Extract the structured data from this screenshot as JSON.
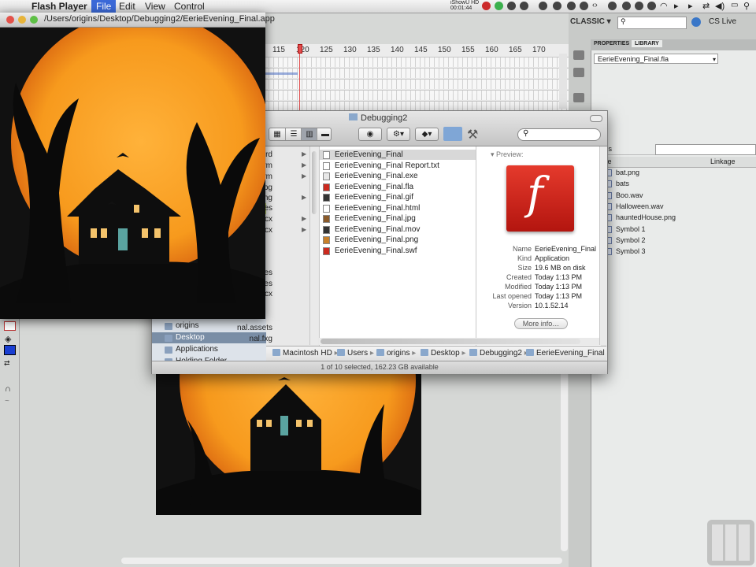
{
  "menubar": {
    "app_name": "Flash Player",
    "items": [
      "File",
      "Edit",
      "View",
      "Control"
    ],
    "recorder": {
      "name": "iShowU HD",
      "time": "00:01:44"
    }
  },
  "ide": {
    "workspace": "CLASSIC",
    "cs_live": "CS Live",
    "panel_tabs": [
      "PROPERTIES",
      "LIBRARY"
    ],
    "library_file": "EerieEvening_Final.fla",
    "library_header": {
      "name_col": "me",
      "linkage_col": "Linkage",
      "items_label": "ems"
    },
    "library_items": [
      "bat.png",
      "bats",
      "Boo.wav",
      "Halloween.wav",
      "hauntedHouse.png",
      "Symbol 1",
      "Symbol 2",
      "Symbol 3"
    ],
    "timeline_frames": [
      "115",
      "120",
      "125",
      "130",
      "135",
      "140",
      "145",
      "150",
      "155",
      "160",
      "165",
      "170"
    ]
  },
  "flash_player": {
    "title_path": "/Users/origins/Desktop/Debugging2/EerieEvening_Final.app"
  },
  "finder": {
    "title": "Debugging2",
    "sidebar_items": [
      "rd",
      "owstorm",
      "owstorm",
      "bell.jpg",
      "hed.png",
      "les",
      "docx",
      "cx",
      "es",
      "Images",
      "pe.docx",
      "origins",
      "Desktop",
      "Applications",
      "Holding Folder",
      "nal.assets",
      "nal.fxg"
    ],
    "files": [
      {
        "name": "EerieEvening_Final",
        "icon": "application-icon"
      },
      {
        "name": "EerieEvening_Final Report.txt",
        "icon": "text-file-icon"
      },
      {
        "name": "EerieEvening_Final.exe",
        "icon": "exe-file-icon"
      },
      {
        "name": "EerieEvening_Final.fla",
        "icon": "fla-file-icon"
      },
      {
        "name": "EerieEvening_Final.gif",
        "icon": "gif-file-icon"
      },
      {
        "name": "EerieEvening_Final.html",
        "icon": "html-file-icon"
      },
      {
        "name": "EerieEvening_Final.jpg",
        "icon": "jpg-file-icon"
      },
      {
        "name": "EerieEvening_Final.mov",
        "icon": "mov-file-icon"
      },
      {
        "name": "EerieEvening_Final.png",
        "icon": "png-file-icon"
      },
      {
        "name": "EerieEvening_Final.swf",
        "icon": "swf-file-icon"
      }
    ],
    "preview_label": "Preview:",
    "meta": [
      {
        "k": "Name",
        "v": "EerieEvening_Final"
      },
      {
        "k": "Kind",
        "v": "Application"
      },
      {
        "k": "Size",
        "v": "19.6 MB on disk"
      },
      {
        "k": "Created",
        "v": "Today 1:13 PM"
      },
      {
        "k": "Modified",
        "v": "Today 1:13 PM"
      },
      {
        "k": "Last opened",
        "v": "Today 1:13 PM"
      },
      {
        "k": "Version",
        "v": "10.1.52.14"
      }
    ],
    "more_info": "More info…",
    "path": [
      "Macintosh HD",
      "Users",
      "origins",
      "Desktop",
      "Debugging2",
      "EerieEvening_Final"
    ],
    "status": "1 of 10 selected, 162.23 GB available"
  },
  "colors": {
    "accent": "#3b69d8",
    "flash_red": "#c8201a",
    "moon": "#f79a1d"
  }
}
